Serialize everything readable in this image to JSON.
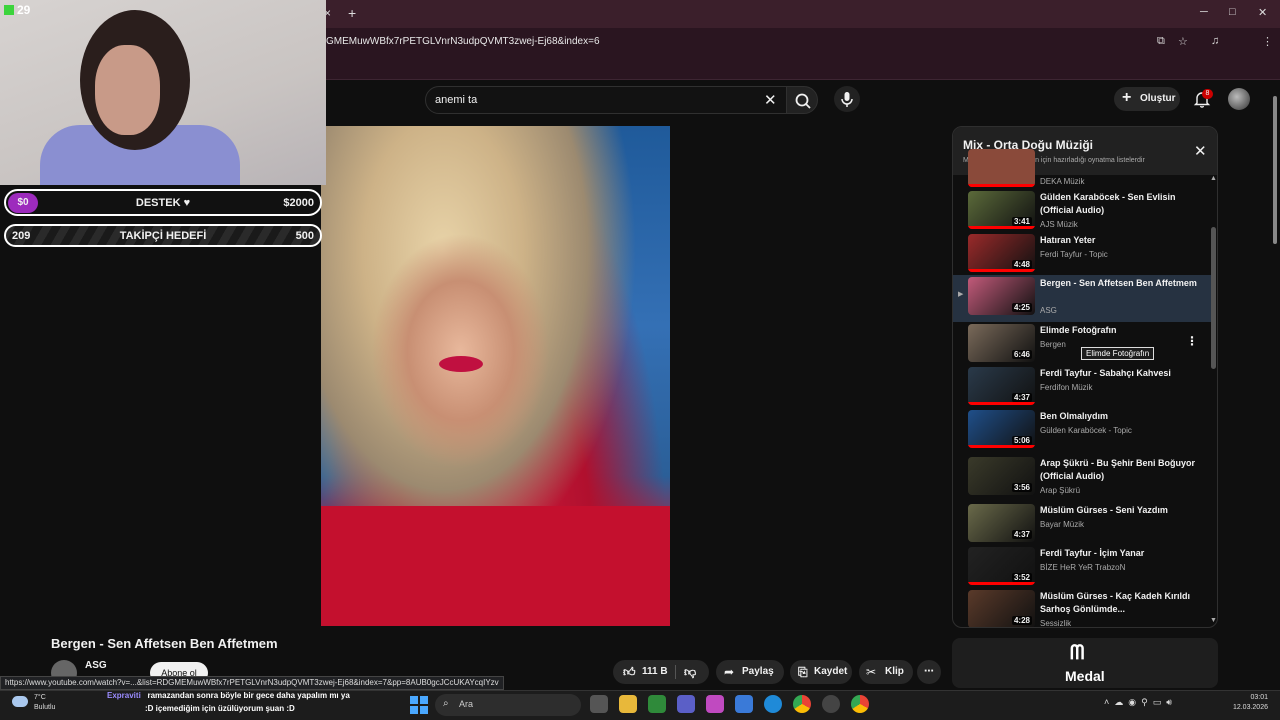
{
  "browser": {
    "url": "GMEMuwWBfx7rPETGLVnrN3udpQVMT3zwej-Ej68&index=6",
    "status_url": "https://www.youtube.com/watch?v=...&list=RDGMEMuwWBfx7rPETGLVnrN3udpQVMT3zwej-Ej68&index=7&pp=8AUB0gcJCcUKAYcqIYzv",
    "tab_close": "×",
    "tab_new": "+",
    "minimize": "─",
    "maximize": "□",
    "close": "✕"
  },
  "stream": {
    "viewer_count": "29",
    "support_left": "$0",
    "support_label": "DESTEK ♥",
    "support_right": "$2000",
    "follower_current": "209",
    "follower_label": "TAKİPÇİ HEDEFİ",
    "follower_goal": "500"
  },
  "header": {
    "search_value": "anemi ta",
    "clear_icon": "✕",
    "create_label": "Oluştur",
    "notification_count": "8"
  },
  "video": {
    "title": "Bergen - Sen Affetsen Ben Affetmem",
    "channel": "ASG",
    "subscribe_label": "Abone ol",
    "like_count": "111 B",
    "share_label": "Paylaş",
    "save_label": "Kaydet",
    "clip_label": "Klip",
    "more_label": "⋯"
  },
  "playlist": {
    "title": "Mix - Orta Doğu Müziği",
    "subtitle": "Mix'ler, YouTube'un sizin için hazırladığı oynatma listelerdir",
    "partial_channel": "DEKA Müzik",
    "items": [
      {
        "title": "Gülden Karaböcek - Sen Evlisin (Official Audio)",
        "channel": "AJS Müzik",
        "duration": "3:41",
        "color": "#5b6a3a"
      },
      {
        "title": "Hatıran Yeter",
        "channel": "Ferdi Tayfur - Topic",
        "duration": "4:48",
        "color": "#9a2a2a"
      },
      {
        "title": "Bergen - Sen Affetsen Ben Affetmem",
        "channel": "ASG",
        "duration": "4:25",
        "color": "#c25a7a"
      },
      {
        "title": "Elimde Fotoğrafın",
        "channel": "Bergen",
        "duration": "6:46",
        "color": "#7a6a5a"
      },
      {
        "title": "Ferdi Tayfur - Sabahçı Kahvesi",
        "channel": "Ferdifon Müzik",
        "duration": "4:37",
        "color": "#2a3a4a"
      },
      {
        "title": "Ben Olmalıydım",
        "channel": "Gülden Karaböcek - Topic",
        "duration": "5:06",
        "color": "#1f4f8a"
      },
      {
        "title": "Arap Şükrü - Bu Şehir Beni Boğuyor (Official Audio)",
        "channel": "Arap Şükrü",
        "duration": "3:56",
        "color": "#3a3a2a"
      },
      {
        "title": "Müslüm Gürses - Seni Yazdım",
        "channel": "Bayar Müzik",
        "duration": "4:37",
        "color": "#6a6a4a"
      },
      {
        "title": "Ferdi Tayfur - İçim Yanar",
        "channel": "BİZE HeR YeR TrabzoN",
        "duration": "3:52",
        "color": "#222222"
      },
      {
        "title": "Müslüm Gürses - Kaç Kadeh Kırıldı Sarhoş Gönlümde...",
        "channel": "Sessizlik",
        "duration": "4:28",
        "color": "#5a3a2a"
      }
    ],
    "tooltip": "Elimde Fotoğrafın",
    "menu_icon": "⋮"
  },
  "ad": {
    "brand": "Medal"
  },
  "chat": {
    "user": "Expraviti",
    "message": "ramazandan sonra böyle bir gece daha yapalım mı ya",
    "message2": ":D içemediğim için üzülüyorum şuan :D"
  },
  "taskbar": {
    "temp": "7°C",
    "condition": "Bulutlu",
    "search_placeholder": "Ara",
    "time": "03:01",
    "date": "12.03.2026"
  },
  "colors": {
    "accent_red": "#ff0000",
    "active_row": "#263241",
    "donation_pill": "#9d2bbd"
  }
}
